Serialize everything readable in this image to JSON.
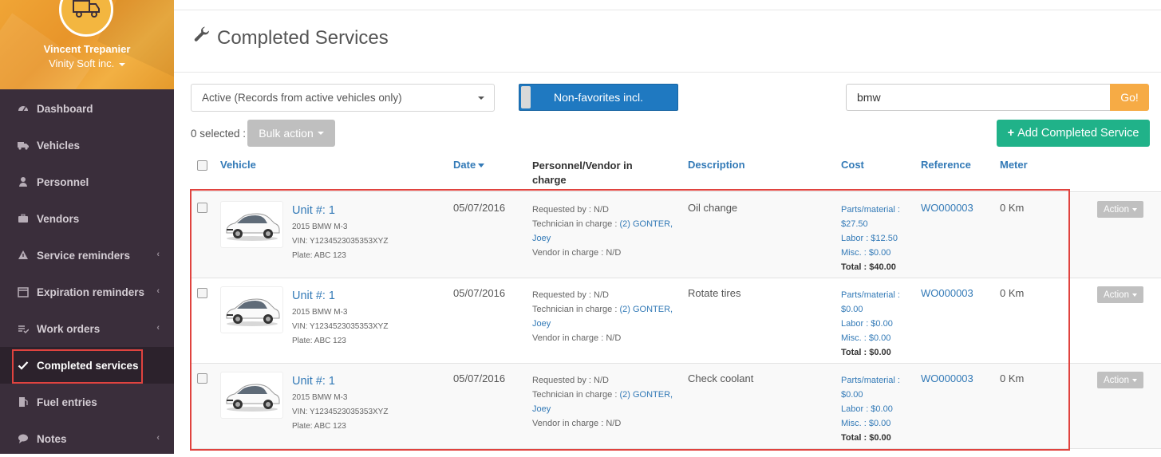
{
  "user": {
    "name": "Vincent Trepanier",
    "org": "Vinity Soft inc."
  },
  "nav": [
    {
      "label": "Dashboard",
      "icon": "dashboard-icon",
      "chevron": false,
      "active": false
    },
    {
      "label": "Vehicles",
      "icon": "truck-icon",
      "chevron": false,
      "active": false
    },
    {
      "label": "Personnel",
      "icon": "user-icon",
      "chevron": false,
      "active": false
    },
    {
      "label": "Vendors",
      "icon": "briefcase-icon",
      "chevron": false,
      "active": false
    },
    {
      "label": "Service reminders",
      "icon": "warning-icon",
      "chevron": true,
      "active": false
    },
    {
      "label": "Expiration reminders",
      "icon": "calendar-icon",
      "chevron": true,
      "active": false
    },
    {
      "label": "Work orders",
      "icon": "checklist-icon",
      "chevron": true,
      "active": false
    },
    {
      "label": "Completed services",
      "icon": "check-icon",
      "chevron": false,
      "active": true
    },
    {
      "label": "Fuel entries",
      "icon": "fuel-icon",
      "chevron": false,
      "active": false
    },
    {
      "label": "Notes",
      "icon": "comment-icon",
      "chevron": true,
      "active": false
    }
  ],
  "page": {
    "title": "Completed Services",
    "title_icon": "wrench-icon"
  },
  "filters": {
    "status_select": "Active (Records from active vehicles only)",
    "favorites_toggle": "Non-favorites incl.",
    "search_value": "bmw",
    "go_label": "Go!"
  },
  "bulk": {
    "selected_text": "0 selected :",
    "bulk_label": "Bulk action"
  },
  "add_button": {
    "label": "Add Completed Service",
    "icon": "plus-icon"
  },
  "columns": {
    "vehicle": "Vehicle",
    "date": "Date",
    "personnel_line1": "Personnel/Vendor in",
    "personnel_line2": "charge",
    "description": "Description",
    "cost": "Cost",
    "reference": "Reference",
    "meter": "Meter"
  },
  "rows": [
    {
      "unit": "Unit #: 1",
      "model": "2015 BMW M-3",
      "vin": "VIN: Y1234523035353XYZ",
      "plate": "Plate: ABC 123",
      "date": "05/07/2016",
      "requested": "Requested by : N/D",
      "tech_prefix": "Technician in charge : ",
      "tech_link1": "(2) GONTER,",
      "tech_link2": "Joey",
      "vendor": "Vendor in charge : N/D",
      "description": "Oil change",
      "parts_label": "Parts/material :",
      "parts_value": "$27.50",
      "labor": "Labor : $12.50",
      "misc": "Misc. : $0.00",
      "total": "Total : $40.00",
      "reference": "WO000003",
      "meter": "0 Km",
      "action": "Action"
    },
    {
      "unit": "Unit #: 1",
      "model": "2015 BMW M-3",
      "vin": "VIN: Y1234523035353XYZ",
      "plate": "Plate: ABC 123",
      "date": "05/07/2016",
      "requested": "Requested by : N/D",
      "tech_prefix": "Technician in charge : ",
      "tech_link1": "(2) GONTER,",
      "tech_link2": "Joey",
      "vendor": "Vendor in charge : N/D",
      "description": "Rotate tires",
      "parts_label": "Parts/material :",
      "parts_value": "$0.00",
      "labor": "Labor : $0.00",
      "misc": "Misc. : $0.00",
      "total": "Total : $0.00",
      "reference": "WO000003",
      "meter": "0 Km",
      "action": "Action"
    },
    {
      "unit": "Unit #: 1",
      "model": "2015 BMW M-3",
      "vin": "VIN: Y1234523035353XYZ",
      "plate": "Plate: ABC 123",
      "date": "05/07/2016",
      "requested": "Requested by : N/D",
      "tech_prefix": "Technician in charge : ",
      "tech_link1": "(2) GONTER,",
      "tech_link2": "Joey",
      "vendor": "Vendor in charge : N/D",
      "description": "Check coolant",
      "parts_label": "Parts/material :",
      "parts_value": "$0.00",
      "labor": "Labor : $0.00",
      "misc": "Misc. : $0.00",
      "total": "Total : $0.00",
      "reference": "WO000003",
      "meter": "0 Km",
      "action": "Action"
    }
  ],
  "colors": {
    "sidebar": "#3a2e3b",
    "accent_blue": "#337ab7",
    "toggle_blue": "#1f79c1",
    "go_orange": "#f6ab45",
    "add_green": "#20b289",
    "highlight_red": "#e0433f"
  }
}
